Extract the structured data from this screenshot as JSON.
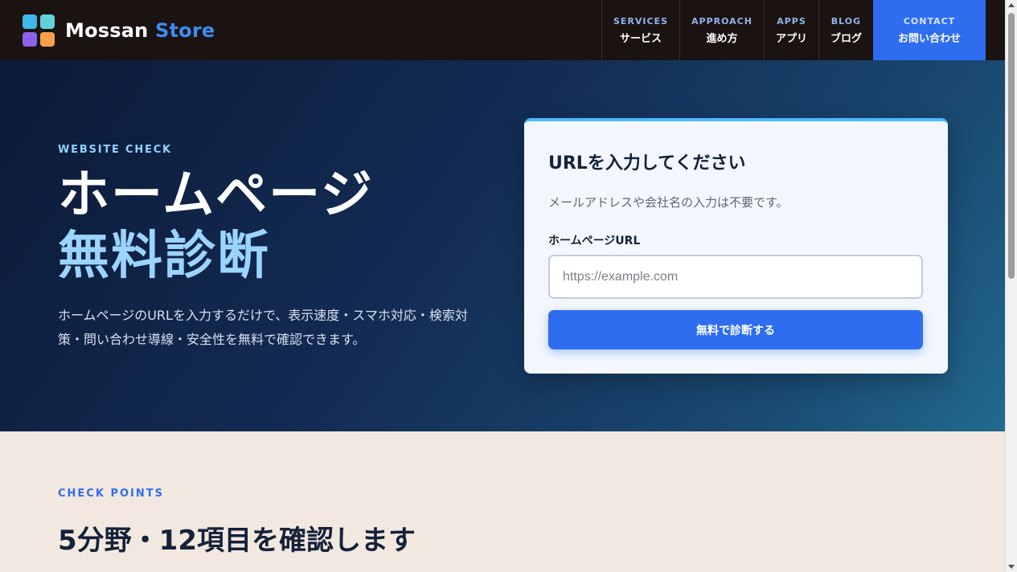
{
  "header": {
    "logo": {
      "name_main": "Mossan",
      "name_accent": "Store",
      "tile_colors": [
        "#3fb8ea",
        "#5fd3d8",
        "#8a63e8",
        "#f5a04a"
      ]
    },
    "nav": [
      {
        "en": "SERVICES",
        "jp": "サービス"
      },
      {
        "en": "APPROACH",
        "jp": "進め方"
      },
      {
        "en": "APPS",
        "jp": "アプリ"
      },
      {
        "en": "BLOG",
        "jp": "ブログ"
      }
    ],
    "contact": {
      "en": "CONTACT",
      "jp": "お問い合わせ"
    }
  },
  "hero": {
    "eyebrow": "WEBSITE CHECK",
    "title_line1": "ホームページ",
    "title_line2": "無料診断",
    "description": "ホームページのURLを入力するだけで、表示速度・スマホ対応・検索対策・問い合わせ導線・安全性を無料で確認できます。"
  },
  "form": {
    "title": "URLを入力してください",
    "subtitle": "メールアドレスや会社名の入力は不要です。",
    "field_label": "ホームページURL",
    "placeholder": "https://example.com",
    "value": "",
    "submit_label": "無料で診断する"
  },
  "check_points": {
    "eyebrow": "CHECK POINTS",
    "title": "5分野・12項目を確認します"
  },
  "colors": {
    "accent": "#2f6df0",
    "header_bg": "#1b1212",
    "hero_title_accent": "#9bd4ff",
    "section_bg": "#f2e8df"
  }
}
